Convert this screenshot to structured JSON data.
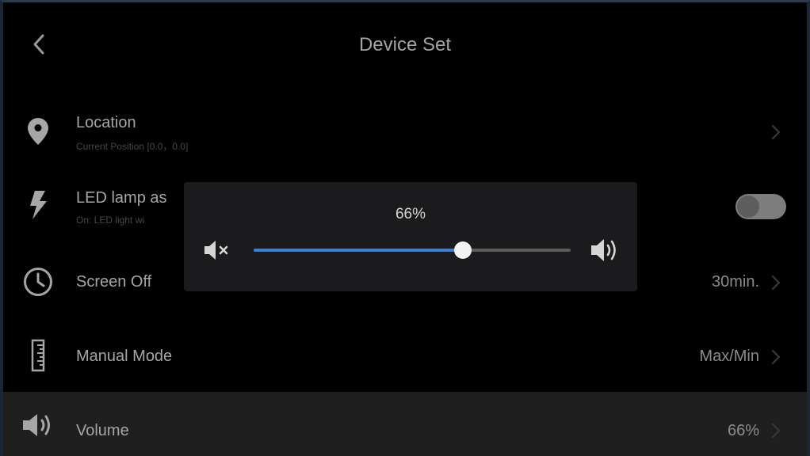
{
  "header": {
    "title": "Device Set"
  },
  "rows": {
    "location": {
      "label": "Location",
      "sub": "Current Position [0.0，0.0]"
    },
    "led": {
      "label": "LED lamp as",
      "sub": "On: LED light wi",
      "toggle_on": false
    },
    "screen_off": {
      "label": "Screen Off",
      "value": "30min."
    },
    "manual_mode": {
      "label": "Manual Mode",
      "value": "Max/Min"
    },
    "volume": {
      "label": "Volume",
      "value": "66%"
    }
  },
  "volume_popup": {
    "percent_label": "66%",
    "level": 0.66
  },
  "colors": {
    "accent": "#3d7fd1",
    "text_primary": "#a6a6a6",
    "text_secondary": "#474747",
    "background": "#000000",
    "active_row": "#1f1f1f",
    "popup_bg": "#1b1b1d"
  },
  "icons": {
    "back": "chevron-left-icon",
    "location": "map-pin-icon",
    "led": "lightning-bolt-icon",
    "screen_off": "clock-icon",
    "manual_mode": "ruler-icon",
    "volume": "speaker-icon",
    "mute": "speaker-mute-icon",
    "loud": "speaker-loud-icon",
    "chevron": "chevron-right-icon"
  }
}
